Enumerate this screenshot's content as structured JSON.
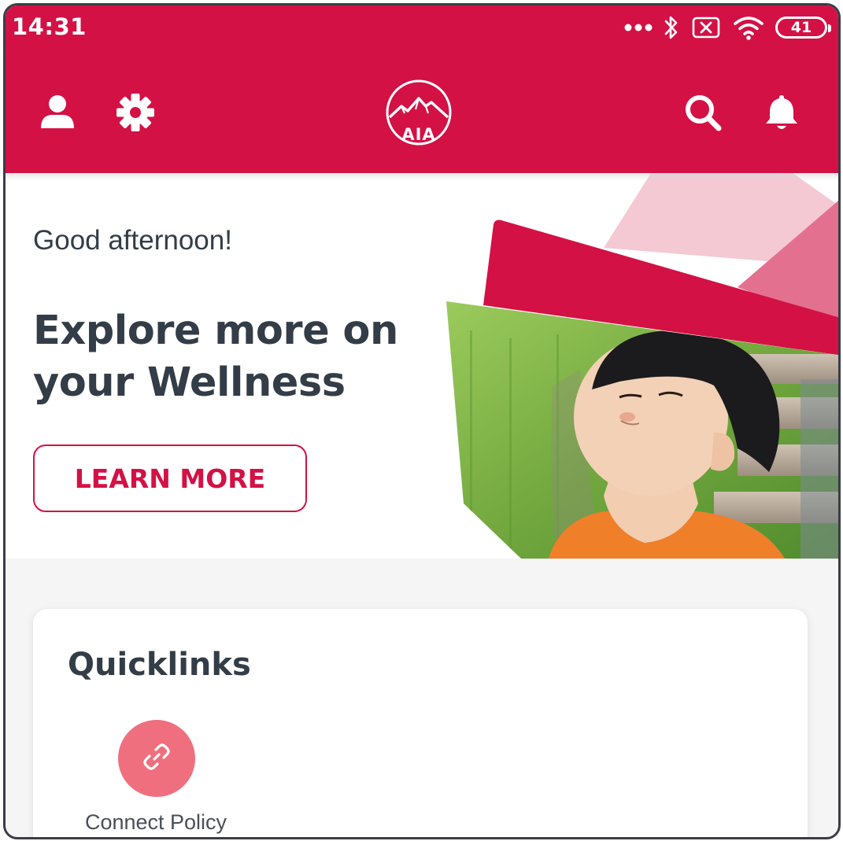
{
  "status_bar": {
    "time": "14:31",
    "battery": "41",
    "icons": [
      "more-dots-icon",
      "bluetooth-icon",
      "sim-off-icon",
      "wifi-icon",
      "battery-icon"
    ]
  },
  "header": {
    "icons": [
      "user-icon",
      "settings-icon",
      "search-icon",
      "notification-bell-icon"
    ],
    "logo_text": "AIA"
  },
  "hero": {
    "greeting": "Good afternoon!",
    "title": "Explore more on your Wellness",
    "cta_label": "LEARN MORE"
  },
  "quicklinks": {
    "title": "Quicklinks",
    "items": [
      {
        "label": "Connect Policy",
        "icon": "link-icon"
      }
    ]
  },
  "colors": {
    "brand": "#d31145",
    "text_dark": "#333d47",
    "quicklink_circle": "#f06f7e",
    "page_bg": "#f5f5f5"
  }
}
